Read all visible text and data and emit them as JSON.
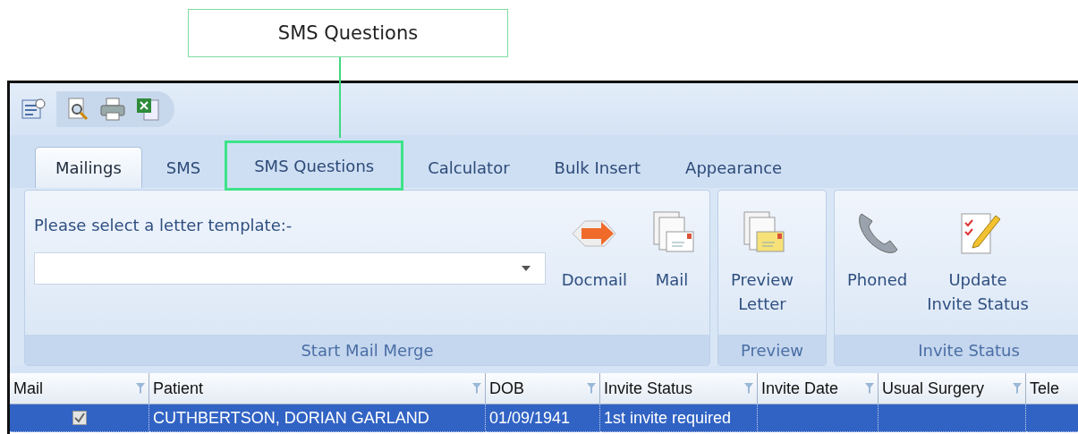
{
  "callout": {
    "label": "SMS Questions"
  },
  "tabs": [
    {
      "label": "Mailings",
      "selected": true,
      "highlighted": false
    },
    {
      "label": "SMS",
      "selected": false,
      "highlighted": false
    },
    {
      "label": "SMS Questions",
      "selected": false,
      "highlighted": true
    },
    {
      "label": "Calculator",
      "selected": false,
      "highlighted": false
    },
    {
      "label": "Bulk Insert",
      "selected": false,
      "highlighted": false
    },
    {
      "label": "Appearance",
      "selected": false,
      "highlighted": false
    }
  ],
  "ribbon": {
    "template_prompt": "Please select a letter template:-",
    "groups": [
      {
        "title": "Start Mail Merge",
        "buttons": [
          {
            "kind": "docmail",
            "label": "Docmail"
          },
          {
            "kind": "mail",
            "label": "Mail"
          }
        ]
      },
      {
        "title": "Preview",
        "buttons": [
          {
            "kind": "preview",
            "label": "Preview Letter"
          }
        ]
      },
      {
        "title": "Invite Status",
        "buttons": [
          {
            "kind": "phone",
            "label": "Phoned"
          },
          {
            "kind": "update",
            "label": "Update Invite Status"
          }
        ]
      }
    ]
  },
  "grid": {
    "columns": [
      "Mail",
      "Patient",
      "DOB",
      "Invite Status",
      "Invite Date",
      "Usual Surgery",
      "Tele"
    ],
    "rows": [
      {
        "selected": true,
        "mail_checked": true,
        "cells": [
          "",
          "CUTHBERTSON, DORIAN GARLAND",
          "01/09/1941",
          "1st invite required",
          "",
          "",
          ""
        ]
      }
    ]
  }
}
